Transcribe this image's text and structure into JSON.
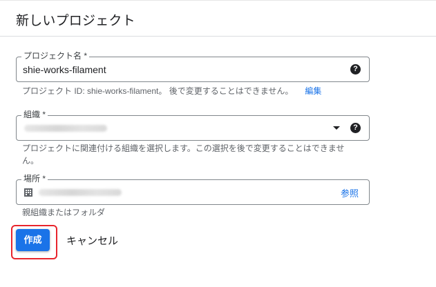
{
  "dialog": {
    "title": "新しいプロジェクト"
  },
  "project_name": {
    "label": "プロジェクト名 *",
    "value": "shie-works-filament",
    "help_icon": "help-icon"
  },
  "project_id_hint": {
    "text": "プロジェクト ID: shie-works-filament。 後で変更することはできません。",
    "edit_label": "編集"
  },
  "organization": {
    "label": "組織 *",
    "value": "",
    "dropdown_icon": "chevron-down-icon",
    "help_icon": "help-icon",
    "hint_line1": "プロジェクトに関連付ける組織を選択します。この選択を後で変更することはできませ",
    "hint_line2": "ん。"
  },
  "location": {
    "label": "場所 *",
    "value": "",
    "icon": "building-icon",
    "browse_label": "参照",
    "hint": "親組織またはフォルダ"
  },
  "actions": {
    "create_label": "作成",
    "cancel_label": "キャンセル"
  },
  "colors": {
    "accent": "#1a73e8",
    "highlight": "#e8242c"
  }
}
